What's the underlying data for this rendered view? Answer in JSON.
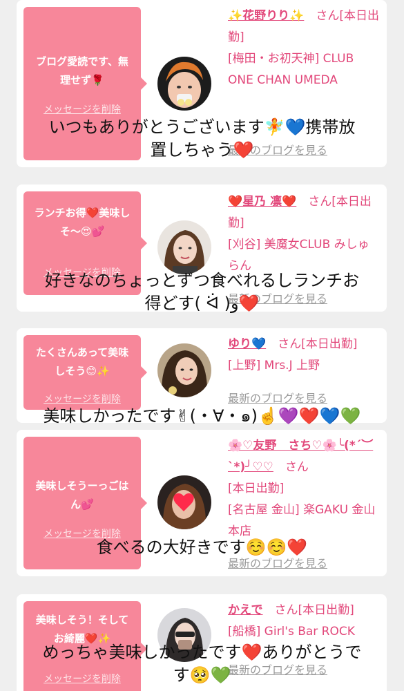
{
  "cards": [
    {
      "message": "ブログ愛読です、無理せず🌹",
      "delete_label": "メッセージを削除",
      "name": "✨花野りり✨",
      "honorific": "さん",
      "status": "[本日出勤]",
      "shop": "[梅田・お初天神] CLUB ONE CHAN UMEDA",
      "blog_label": "最新のブログを見る",
      "overlay": "いつもありがとうございます🧚💙携帯放\n置しちゃう❤️"
    },
    {
      "message": "ランチお得❤️美味しそ〜😍💕",
      "delete_label": "メッセージを削除",
      "name": "❤️星乃 凛❤️",
      "honorific": "さん",
      "status": "[本日出勤]",
      "shop": "[刈谷] 美魔女CLUB みしゅらん",
      "blog_label": "最新のブログを見る",
      "overlay": "好きなのちょっとずつ食べれるしランチお\n得どす( ᐛ )و❤️"
    },
    {
      "message": "たくさんあって美味しそう😊✨",
      "delete_label": "メッセージを削除",
      "name": "ゆり💙",
      "honorific": "さん",
      "status": "[本日出勤]",
      "shop": "[上野] Mrs.J 上野",
      "blog_label": "最新のブログを見る",
      "overlay": "美味しかったです✌︎(・∀・๑)☝️💜❤️💙💚"
    },
    {
      "message": "美味しそうーっごはん💕",
      "delete_label": "メッセージを削除",
      "name": "🌸♡友野　さち♡🌸╰(*´︶`*)╯♡♡",
      "honorific": "さん",
      "status": "[本日出勤]",
      "shop": "[名古屋 金山] 楽GAKU 金山本店",
      "blog_label": "最新のブログを見る",
      "overlay": "食べるの大好きです☺️☺️❤️"
    },
    {
      "message": "美味しそう！そしてお綺麗❤️✨",
      "delete_label": "メッセージを削除",
      "name": "かえで",
      "honorific": "さん",
      "status": "[本日出勤]",
      "shop": "[船橋] Girl's Bar ROCK",
      "blog_label": "最新のブログを見る",
      "overlay": "めっちゃ美味しかったです❤️ありがとうで\nす🥺💚"
    }
  ],
  "colors": {
    "bubble": "#f7879a",
    "name_pink": "#e2477a",
    "background": "#efefef"
  }
}
